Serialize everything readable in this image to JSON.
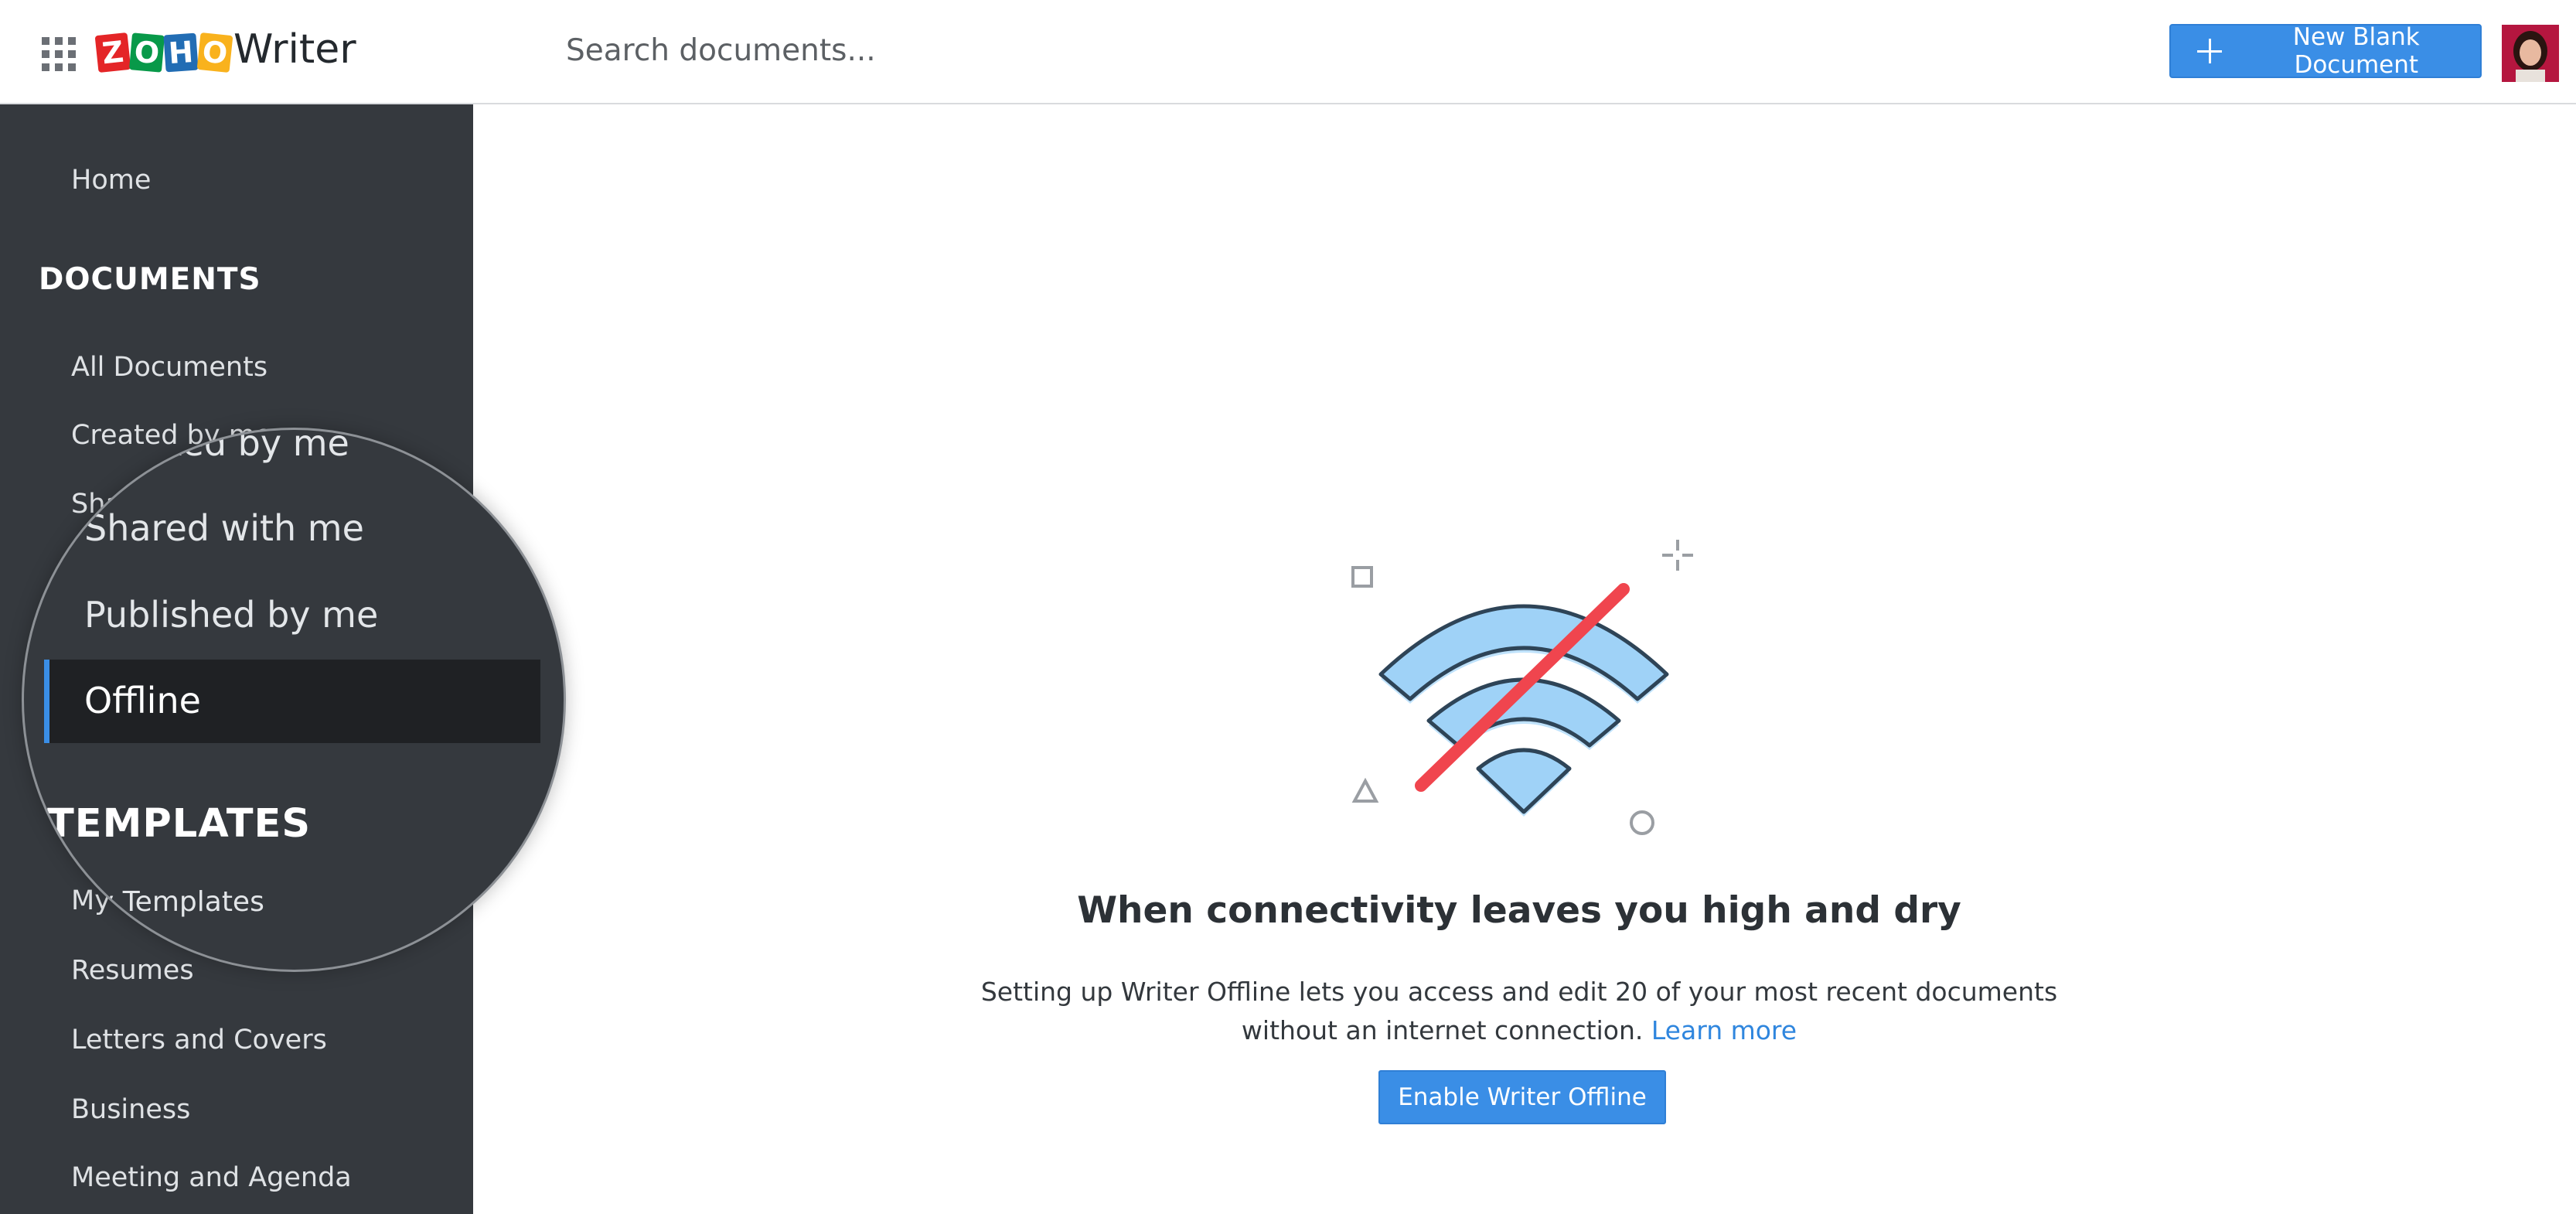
{
  "header": {
    "logo_letters": [
      "Z",
      "O",
      "H",
      "O"
    ],
    "logo_colors": [
      "#e42527",
      "#089949",
      "#226db4",
      "#f9b21d"
    ],
    "app_name": "Writer",
    "search_placeholder": "Search documents...",
    "new_doc_label": "New Blank Document"
  },
  "sidebar": {
    "home": "Home",
    "documents_heading": "DOCUMENTS",
    "document_items": [
      "All Documents",
      "Created by me",
      "Shared with me",
      "Published by me",
      "Offline"
    ],
    "templates_heading": "TEMPLATES",
    "template_items": [
      "My Templates",
      "Resumes",
      "Letters and Covers",
      "Business",
      "Meeting and Agenda"
    ],
    "active_item": "Offline"
  },
  "main": {
    "headline": "When connectivity leaves you high and dry",
    "description_line1": "Setting up Writer Offline lets you access and edit 20 of your most recent documents",
    "description_line2": "without an internet connection.",
    "learn_more": "Learn more",
    "enable_button": "Enable Writer Offline",
    "icon": "wifi-off-icon"
  },
  "colors": {
    "accent": "#3a8ee6",
    "sidebar_bg": "#35393e",
    "slash": "#f0454e",
    "wifi_fill": "#9fd2f7"
  }
}
